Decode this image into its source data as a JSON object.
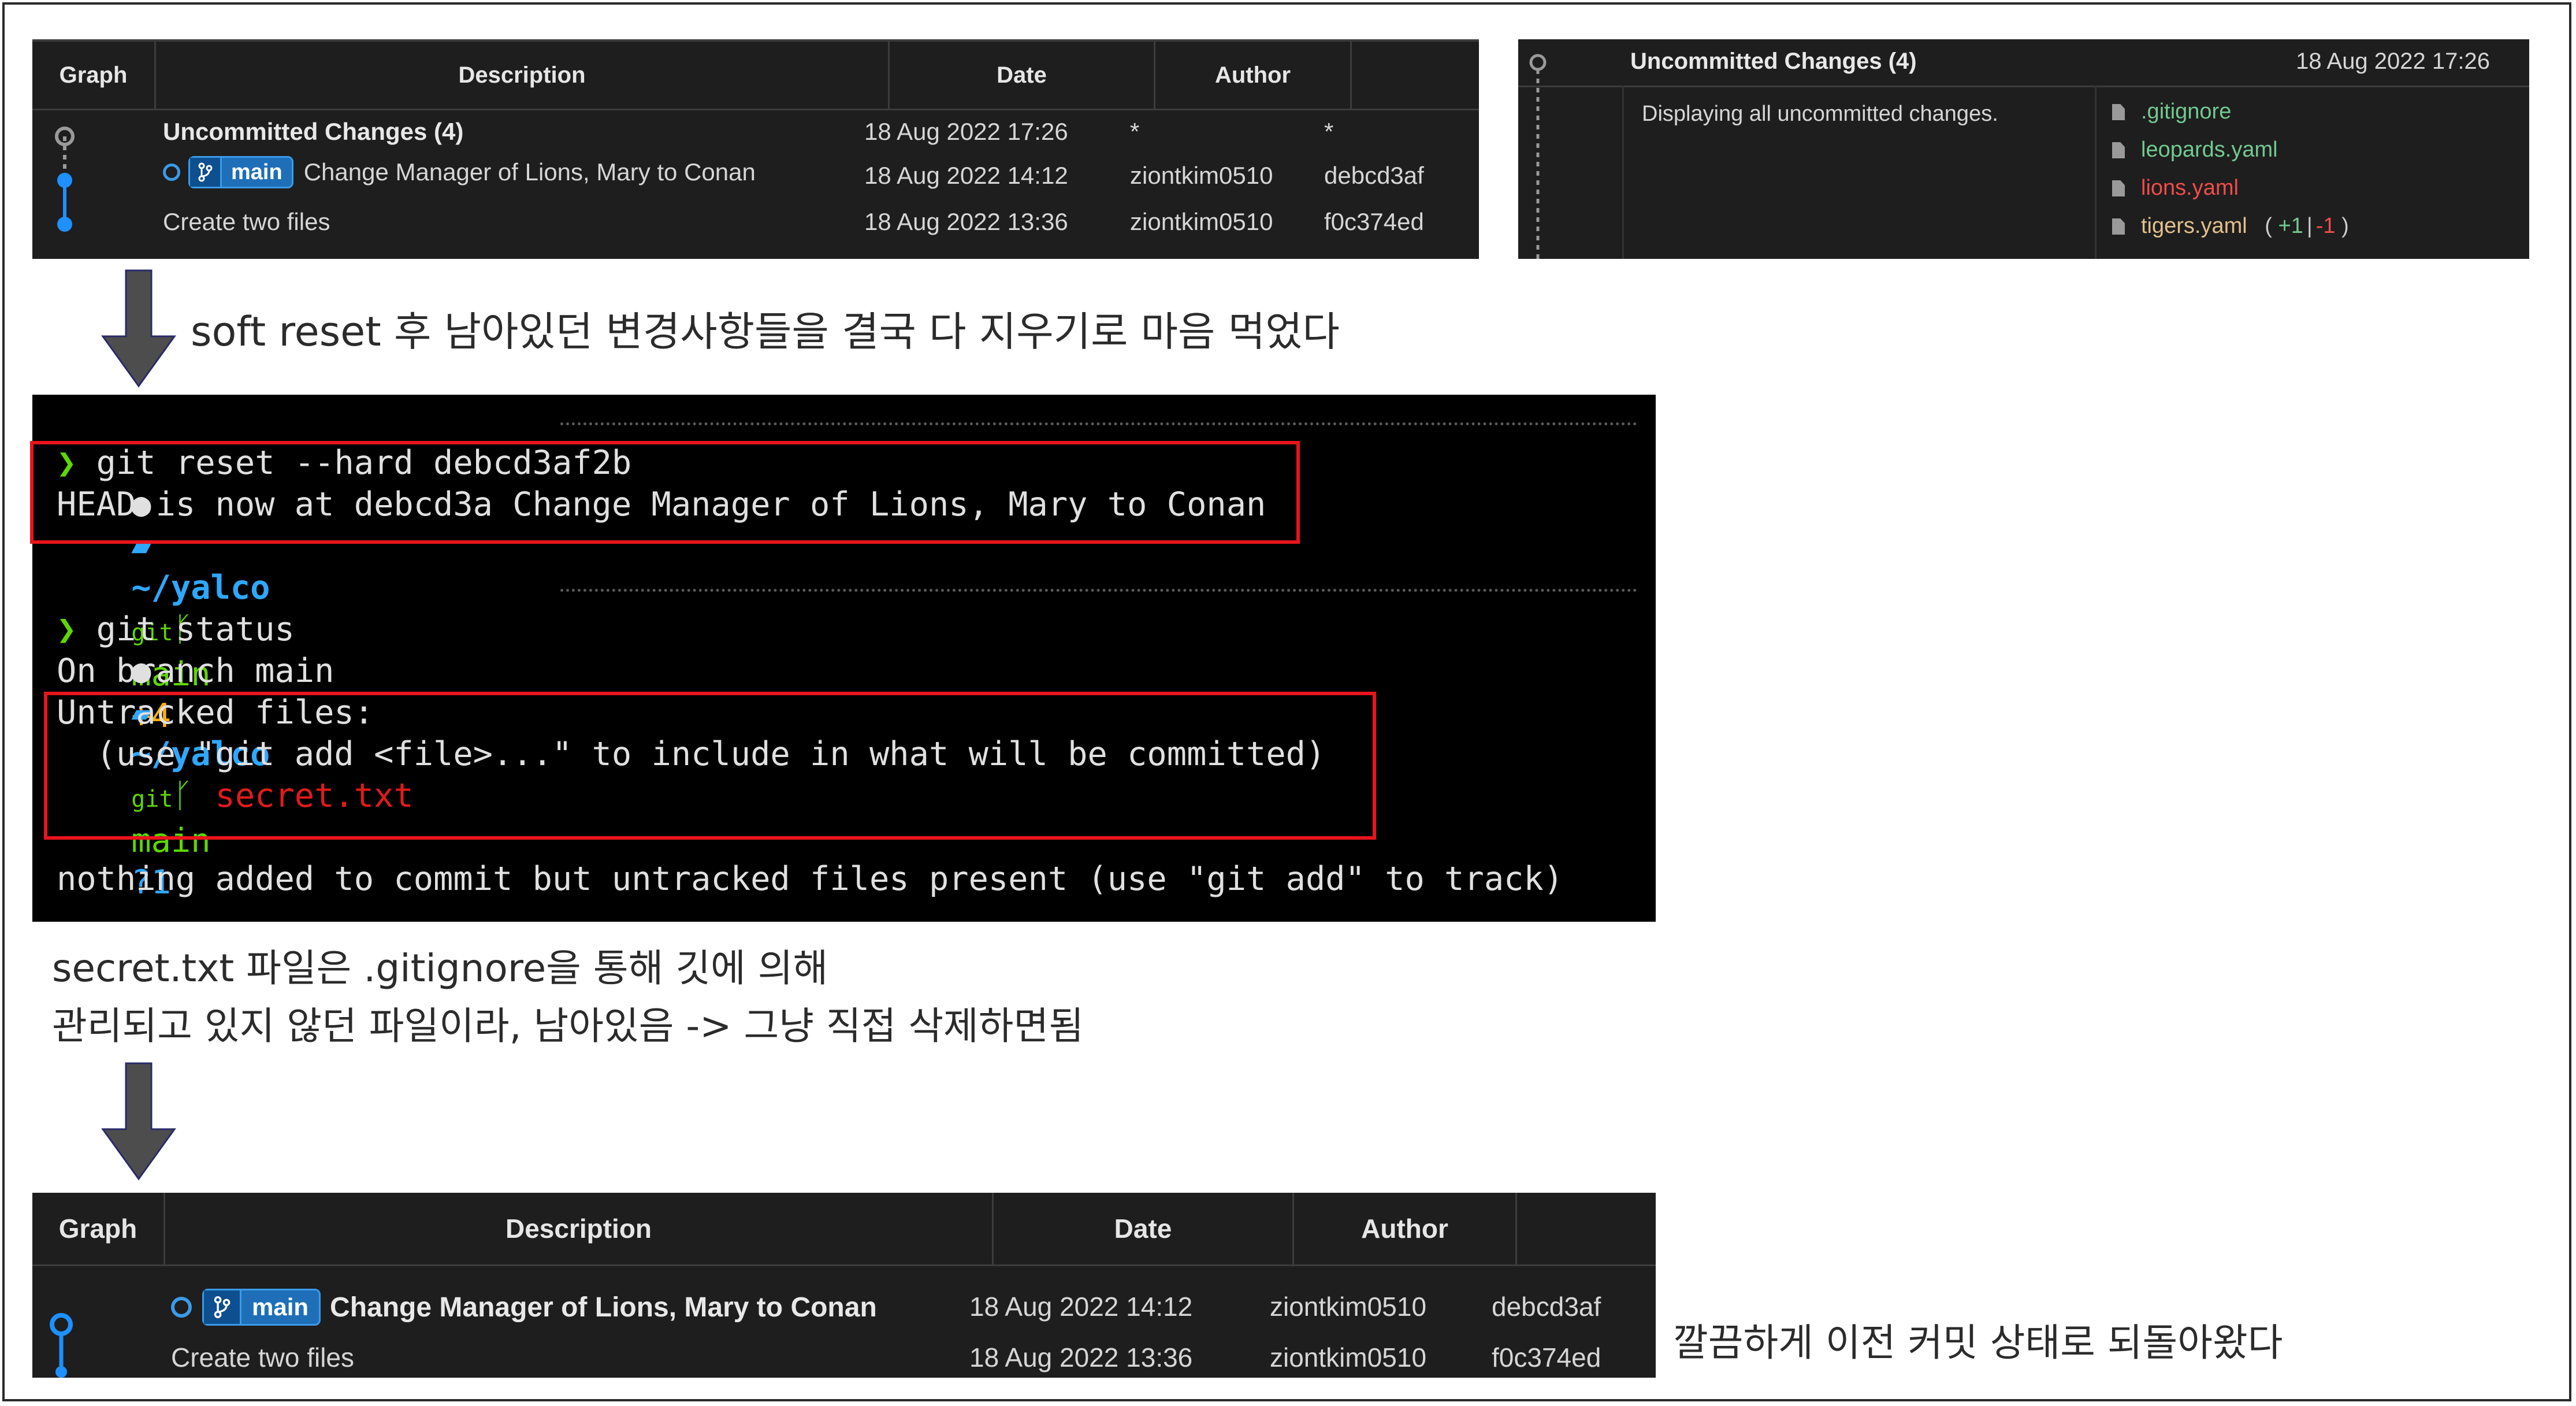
{
  "top_graph": {
    "headers": [
      "Graph",
      "Description",
      "Date",
      "Author",
      ""
    ],
    "rows": [
      {
        "description": "Uncommitted Changes (4)",
        "date": "18 Aug 2022 17:26",
        "author": "*",
        "commit": "*"
      },
      {
        "branch": "main",
        "description": "Change Manager of Lions, Mary to Conan",
        "date": "18 Aug 2022 14:12",
        "author": "ziontkim0510",
        "commit": "debcd3af"
      },
      {
        "description": "Create two files",
        "date": "18 Aug 2022 13:36",
        "author": "ziontkim0510",
        "commit": "f0c374ed"
      }
    ]
  },
  "details": {
    "title": "Uncommitted Changes (4)",
    "date": "18 Aug 2022 17:26",
    "message": "Displaying all uncommitted changes.",
    "files": [
      {
        "name": ".gitignore",
        "color": "#73c991"
      },
      {
        "name": "leopards.yaml",
        "color": "#73c991"
      },
      {
        "name": "lions.yaml",
        "color": "#f14c4c"
      },
      {
        "name": "tigers.yaml",
        "color": "#e2c08d",
        "stat_open": "(",
        "added": "+1",
        "sep": "|",
        "removed": "-1",
        "stat_close": ")"
      }
    ]
  },
  "caption1": "soft reset 후 남아있던 변경사항들을 결국 다 지우기로 마음 먹었다",
  "terminal": {
    "prompt1": {
      "path": "~/yalco",
      "git": "git",
      "branch": "main",
      "status": "+4"
    },
    "cmd1": "git reset --hard debcd3af2b",
    "out1": "HEAD is now at debcd3a Change Manager of Lions, Mary to Conan",
    "prompt2": {
      "path": "~/yalco",
      "git": "git",
      "branch": "main",
      "status": "?1"
    },
    "cmd2": "git status",
    "out2": "On branch main",
    "untracked_title": "Untracked files:",
    "untracked_hint": "  (use \"git add <file>...\" to include in what will be committed)",
    "untracked_file": "        secret.txt",
    "out_final": "nothing added to commit but untracked files present (use \"git add\" to track)",
    "prompt_char": "❯"
  },
  "caption2_line1": "secret.txt 파일은 .gitignore을 통해 깃에 의해",
  "caption2_line2": "관리되고 있지 않던 파일이라, 남아있음 -> 그냥 직접 삭제하면됨",
  "bottom_graph": {
    "headers": [
      "Graph",
      "Description",
      "Date",
      "Author",
      ""
    ],
    "rows": [
      {
        "branch": "main",
        "description": "Change Manager of Lions, Mary to Conan",
        "date": "18 Aug 2022 14:12",
        "author": "ziontkim0510",
        "commit": "debcd3af"
      },
      {
        "description": "Create two files",
        "date": "18 Aug 2022 13:36",
        "author": "ziontkim0510",
        "commit": "f0c374ed"
      }
    ]
  },
  "caption3": "깔끔하게 이전 커밋 상태로 되돌아왔다",
  "colors": {
    "panel_bg": "#1e1e1e",
    "terminal_bg": "#000000",
    "highlight_box": "#e8141c",
    "branch_badge": "#1e6fb8",
    "terminal_path": "#2ea8ff",
    "terminal_branch": "#5fd700",
    "terminal_status_added": "#ffb000",
    "terminal_status_untracked": "#2ea8ff",
    "terminal_error": "#e01b1b"
  }
}
